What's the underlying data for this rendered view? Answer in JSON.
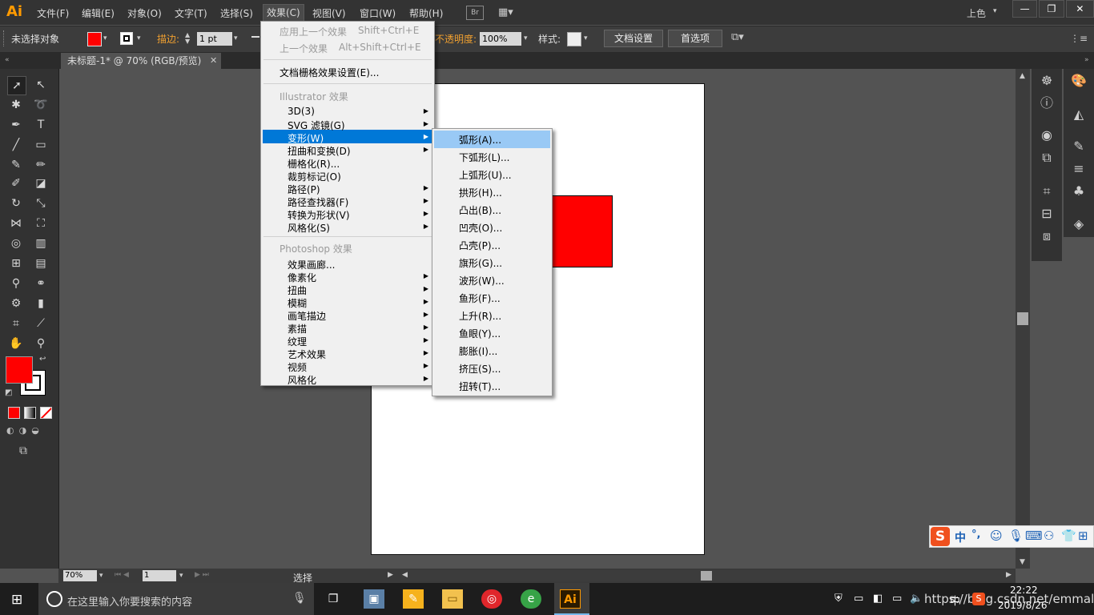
{
  "app": {
    "logo": "Ai"
  },
  "menubar": {
    "items": [
      "文件(F)",
      "编辑(E)",
      "对象(O)",
      "文字(T)",
      "选择(S)",
      "效果(C)",
      "视图(V)",
      "窗口(W)",
      "帮助(H)"
    ],
    "bridge": "Br",
    "workspace": "上色",
    "window_controls": [
      "—",
      "❐",
      "✕"
    ]
  },
  "controlbar": {
    "selection_status": "未选择对象",
    "stroke_label": "描边:",
    "stroke_weight": "1 pt",
    "opacity_label": "不透明度:",
    "opacity_value": "100%",
    "style_label": "样式:",
    "doc_settings_button": "文档设置",
    "preferences_button": "首选项"
  },
  "document": {
    "tab_title": "未标题-1* @ 70% (RGB/预览)",
    "tab_close": "✕",
    "fill_color": "#ff0000"
  },
  "effect_menu": {
    "apply_last": "应用上一个效果",
    "apply_last_shortcut": "Shift+Ctrl+E",
    "last_effect": "上一个效果",
    "last_effect_shortcut": "Alt+Shift+Ctrl+E",
    "raster_settings": "文档栅格效果设置(E)...",
    "illustrator_header": "Illustrator 效果",
    "illustrator_items": [
      "3D(3)",
      "SVG 滤镜(G)",
      "变形(W)",
      "扭曲和变换(D)",
      "栅格化(R)...",
      "裁剪标记(O)",
      "路径(P)",
      "路径查找器(F)",
      "转换为形状(V)",
      "风格化(S)"
    ],
    "photoshop_header": "Photoshop 效果",
    "photoshop_items": [
      "效果画廊...",
      "像素化",
      "扭曲",
      "模糊",
      "画笔描边",
      "素描",
      "纹理",
      "艺术效果",
      "视频",
      "风格化"
    ]
  },
  "warp_submenu": {
    "items": [
      "弧形(A)...",
      "下弧形(L)...",
      "上弧形(U)...",
      "拱形(H)...",
      "凸出(B)...",
      "凹壳(O)...",
      "凸壳(P)...",
      "旗形(G)...",
      "波形(W)...",
      "鱼形(F)...",
      "上升(R)...",
      "鱼眼(Y)...",
      "膨胀(I)...",
      "挤压(S)...",
      "扭转(T)..."
    ]
  },
  "statusbar": {
    "zoom": "70%",
    "page": "1",
    "tool_status": "选择"
  },
  "ime": {
    "logo": "S",
    "mode": "中",
    "punct": "°,"
  },
  "taskbar": {
    "search_placeholder": "在这里输入你要搜索的内容",
    "tray_text": "中",
    "watermark": "https://blog.csdn.net/emmal_",
    "time": "22:22",
    "date": "2019/8/26"
  }
}
